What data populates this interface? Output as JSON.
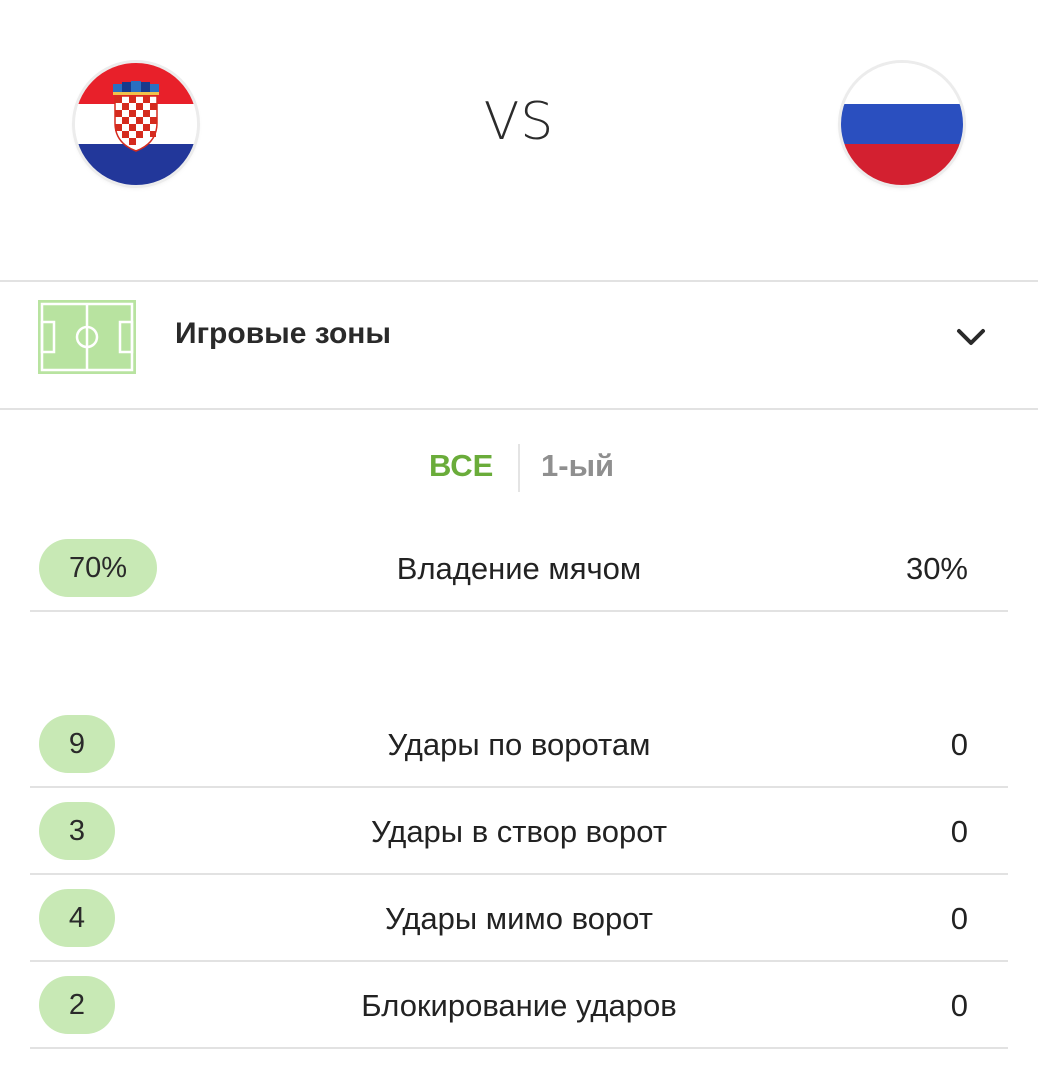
{
  "header": {
    "home_team": {
      "flag_icon": "croatia-flag-icon"
    },
    "away_team": {
      "flag_icon": "russia-flag-icon"
    },
    "vs_label": "VS"
  },
  "section": {
    "icon": "football-pitch-icon",
    "title": "Игровые зоны",
    "toggle_icon": "chevron-down-icon"
  },
  "tabs": [
    {
      "label": "ВСЕ",
      "active": true
    },
    {
      "label": "1-ый",
      "active": false
    }
  ],
  "stats": {
    "possession": {
      "label": "Владение мячом",
      "home": "70%",
      "away": "30%"
    },
    "shots": {
      "label": "Удары по воротам",
      "home": "9",
      "away": "0"
    },
    "on_target": {
      "label": "Удары в створ ворот",
      "home": "3",
      "away": "0"
    },
    "off_target": {
      "label": "Удары мимо ворот",
      "home": "4",
      "away": "0"
    },
    "blocked": {
      "label": "Блокирование ударов",
      "home": "2",
      "away": "0"
    }
  },
  "colors": {
    "accent_green": "#6aac3a",
    "pill_green": "#c8e9b5",
    "tab_inactive": "#8f8f8f",
    "divider": "#e2e2e2"
  }
}
